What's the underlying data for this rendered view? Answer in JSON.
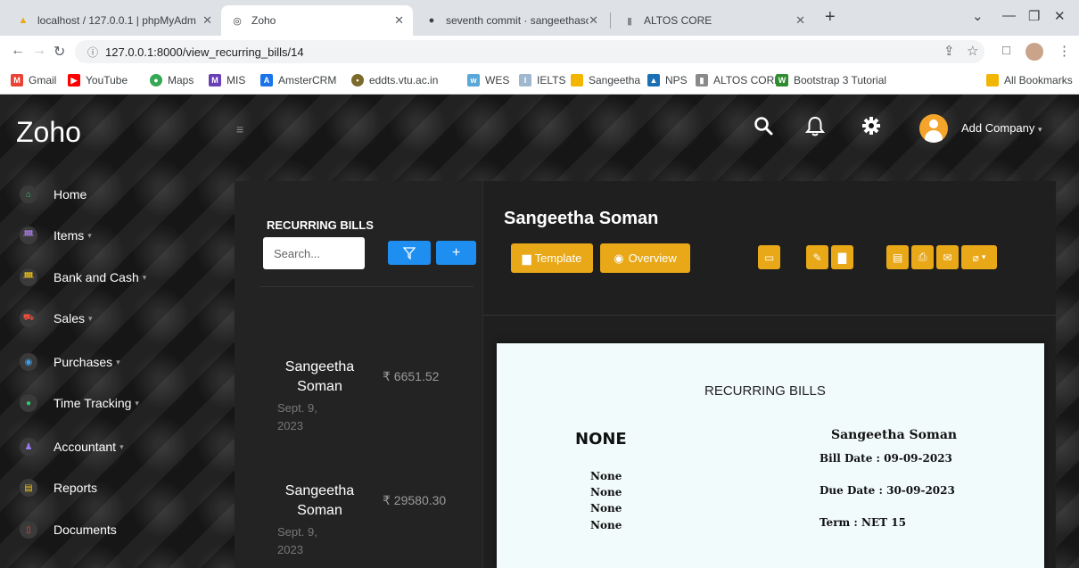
{
  "browser": {
    "tabs": [
      {
        "label": "localhost / 127.0.0.1 | phpMyAdm",
        "icon": "phpmyadmin-icon"
      },
      {
        "label": "Zoho",
        "icon": "globe-icon"
      },
      {
        "label": "seventh commit · sangeethasom",
        "icon": "github-icon"
      },
      {
        "label": "ALTOS CORE",
        "icon": "altos-icon"
      }
    ],
    "address": "127.0.0.1:8000/view_recurring_bills/14",
    "bookmarks": [
      {
        "label": "Gmail",
        "color": "#ea4335"
      },
      {
        "label": "YouTube",
        "color": "#ff0000"
      },
      {
        "label": "Maps",
        "color": "#34a853"
      },
      {
        "label": "MIS",
        "color": "#6a3fb5"
      },
      {
        "label": "AmsterCRM",
        "color": "#1a73e8"
      },
      {
        "label": "eddts.vtu.ac.in",
        "color": "#7b6a2a"
      },
      {
        "label": "WES",
        "color": "#5aa7d9"
      },
      {
        "label": "IELTS",
        "color": "#9fb8d0"
      },
      {
        "label": "Sangeetha",
        "color": "#f2b600"
      },
      {
        "label": "NPS",
        "color": "#1a6fb5"
      },
      {
        "label": "ALTOS CORE",
        "color": "#8a8a8a"
      },
      {
        "label": "Bootstrap 3 Tutorial",
        "color": "#2e8b2e"
      }
    ],
    "all_bookmarks": "All Bookmarks"
  },
  "header": {
    "brand": "Zoho",
    "company": "Add Company"
  },
  "sidebar": {
    "items": [
      {
        "label": "Home",
        "icon": "home-icon",
        "caret": ""
      },
      {
        "label": "Items",
        "icon": "items-icon",
        "caret": "▾"
      },
      {
        "label": "Bank and Cash",
        "icon": "bank-icon",
        "caret": "▾"
      },
      {
        "label": "Sales",
        "icon": "cart-icon",
        "caret": "▾"
      },
      {
        "label": "Purchases",
        "icon": "basket-icon",
        "caret": "▾"
      },
      {
        "label": "Time Tracking",
        "icon": "clock-icon",
        "caret": "▾"
      },
      {
        "label": "Accountant",
        "icon": "user-icon",
        "caret": "▾"
      },
      {
        "label": "Reports",
        "icon": "reports-icon",
        "caret": ""
      },
      {
        "label": "Documents",
        "icon": "documents-icon",
        "caret": ""
      }
    ]
  },
  "list": {
    "title": "RECURRING BILLS",
    "search_placeholder": "Search...",
    "bills": [
      {
        "name": "Sangeetha Soman",
        "date": "Sept. 9, 2023",
        "amount": "₹ 6651.52"
      },
      {
        "name": "Sangeetha Soman",
        "date": "Sept. 9, 2023",
        "amount": "₹ 29580.30"
      }
    ]
  },
  "detail": {
    "customer": "Sangeetha Soman",
    "template_label": "Template",
    "overview_label": "Overview",
    "document": {
      "title": "RECURRING BILLS",
      "vendor": "NONE",
      "address_lines": [
        "None",
        "None",
        "None",
        "None"
      ],
      "customer": "Sangeetha Soman",
      "bill_date": "Bill Date :  09-09-2023",
      "due_date": "Due Date :  30-09-2023",
      "term": "Term :  NET 15"
    }
  },
  "colors": {
    "accent_yellow": "#e8a818",
    "accent_blue": "#1e8ff0"
  }
}
